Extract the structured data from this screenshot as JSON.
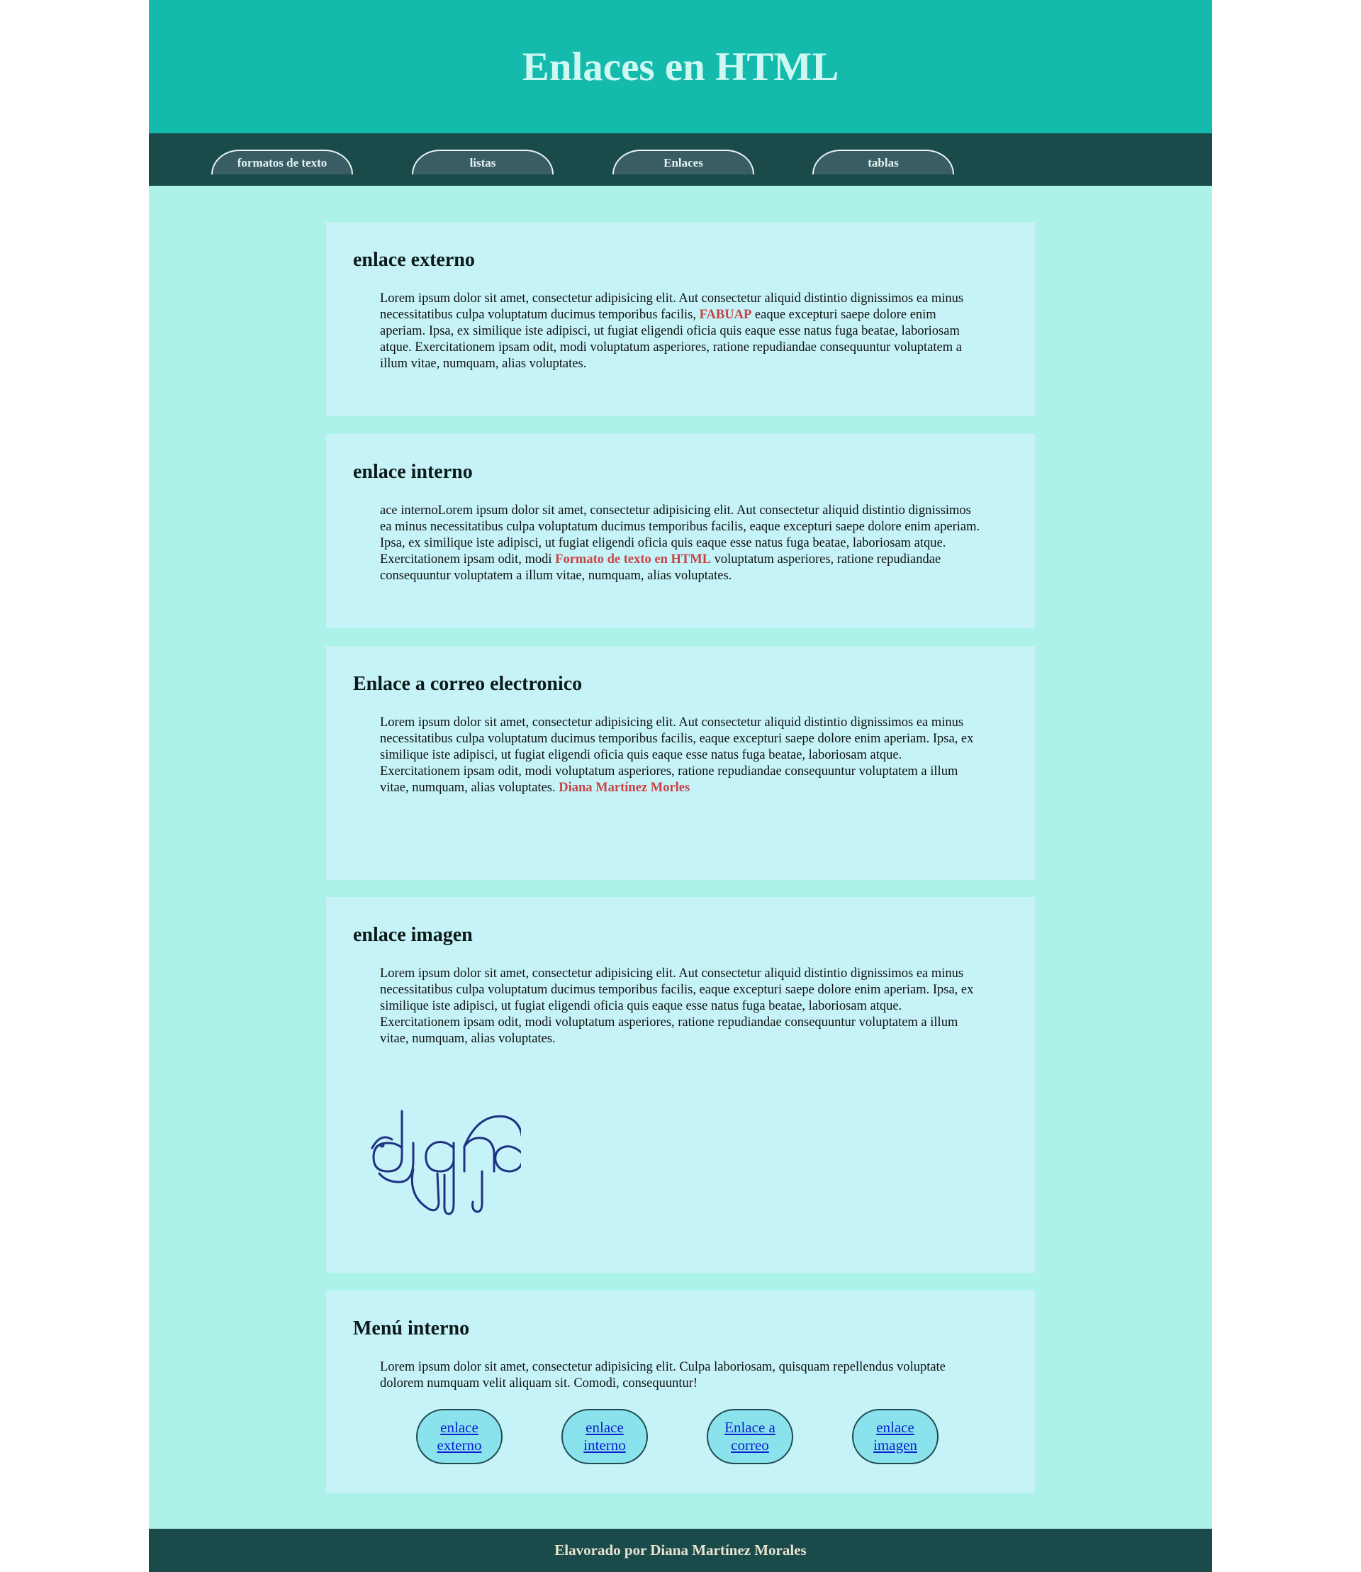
{
  "header": {
    "title": "Enlaces en HTML"
  },
  "nav": {
    "tabs": [
      "formatos de texto",
      "listas",
      "Enlaces",
      "tablas"
    ]
  },
  "sections": {
    "externo": {
      "heading": "enlace externo",
      "text_before": "Lorem ipsum dolor sit amet, consectetur adipisicing elit. Aut consectetur aliquid distintio dignissimos ea minus necessitatibus culpa voluptatum ducimus temporibus facilis, ",
      "link": "FABUAP",
      "text_after": " eaque excepturi saepe dolore enim aperiam. Ipsa, ex similique iste adipisci, ut fugiat eligendi oficia quis eaque esse natus fuga beatae, laboriosam atque. Exercitationem ipsam odit, modi voluptatum asperiores, ratione repudiandae consequuntur voluptatem a illum vitae, numquam, alias voluptates."
    },
    "interno": {
      "heading": "enlace interno",
      "text_before": "ace internoLorem ipsum dolor sit amet, consectetur adipisicing elit. Aut consectetur aliquid distintio dignissimos ea minus necessitatibus culpa voluptatum ducimus temporibus facilis, eaque excepturi saepe dolore enim aperiam. Ipsa, ex similique iste adipisci, ut fugiat eligendi oficia quis eaque esse natus fuga beatae, laboriosam atque. Exercitationem ipsam odit, modi ",
      "link": "Formato de texto en HTML",
      "text_after": " voluptatum asperiores, ratione repudiandae consequuntur voluptatem a illum vitae, numquam, alias voluptates."
    },
    "correo": {
      "heading": "Enlace a correo electronico",
      "text_before": "Lorem ipsum dolor sit amet, consectetur adipisicing elit. Aut consectetur aliquid distintio dignissimos ea minus necessitatibus culpa voluptatum ducimus temporibus facilis, eaque excepturi saepe dolore enim aperiam. Ipsa, ex similique iste adipisci, ut fugiat eligendi oficia quis eaque esse natus fuga beatae, laboriosam atque. Exercitationem ipsam odit, modi voluptatum asperiores, ratione repudiandae consequuntur voluptatem a illum vitae, numquam, alias voluptates. ",
      "link": "Diana Martínez Morles"
    },
    "imagen": {
      "heading": "enlace imagen",
      "text": "Lorem ipsum dolor sit amet, consectetur adipisicing elit. Aut consectetur aliquid distintio dignissimos ea minus necessitatibus culpa voluptatum ducimus temporibus facilis, eaque excepturi saepe dolore enim aperiam. Ipsa, ex similique iste adipisci, ut fugiat eligendi oficia quis eaque esse natus fuga beatae, laboriosam atque. Exercitationem ipsam odit, modi voluptatum asperiores, ratione repudiandae consequuntur voluptatem a illum vitae, numquam, alias voluptates.",
      "logo_text": "diana"
    },
    "menu": {
      "heading": "Menú interno",
      "text": "Lorem ipsum dolor sit amet, consectetur adipisicing elit. Culpa laboriosam, quisquam repellendus voluptate dolorem numquam velit aliquam sit. Comodi, consequuntur!",
      "links": [
        {
          "line1": "enlace",
          "line2": "externo"
        },
        {
          "line1": "enlace",
          "line2": "interno"
        },
        {
          "line1": "Enlace a",
          "line2": "correo"
        },
        {
          "line1": "enlace",
          "line2": "imagen"
        }
      ]
    }
  },
  "footer": {
    "text": "Elavorado por Diana Martínez Morales"
  },
  "colors": {
    "header_bg": "#14bbad",
    "nav_bg": "#1b4a4b",
    "page_bg": "#adf2e9",
    "section_bg": "#c6f3f8",
    "link_red": "#c84444",
    "pill_bg": "#8ae3ec",
    "logo_stroke": "#1f3282"
  }
}
